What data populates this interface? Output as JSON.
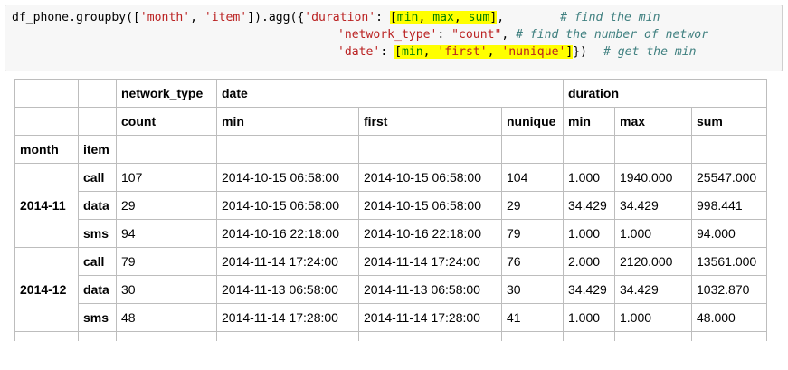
{
  "code": {
    "line1": {
      "prefix": "df_phone.groupby([",
      "s_month": "'month'",
      "comma1": ", ",
      "s_item": "'item'",
      "mid": "]).agg({",
      "s_duration": "'duration'",
      "colon1": ": ",
      "hl": {
        "open": "[",
        "min": "min",
        "c1": ", ",
        "max": "max",
        "c2": ", ",
        "sum": "sum",
        "close": "]"
      },
      "tail": ",",
      "comment": "# find the min"
    },
    "line2": {
      "s_network_type": "'network_type'",
      "colon": ": ",
      "s_count": "\"count\"",
      "tail": ", ",
      "comment": "# find the number of networ"
    },
    "line3": {
      "s_date": "'date'",
      "colon": ": ",
      "hl": {
        "open": "[",
        "min": "min",
        "c1": ", ",
        "s_first": "'first'",
        "c2": ", ",
        "s_nunique": "'nunique'",
        "close": "]"
      },
      "tail": "})",
      "comment": "# get the min"
    }
  },
  "table": {
    "header_row1": [
      "",
      "",
      "network_type",
      "date",
      "duration"
    ],
    "header_row2": [
      "",
      "",
      "count",
      "min",
      "first",
      "nunique",
      "min",
      "max",
      "sum"
    ],
    "index_names": [
      "month",
      "item"
    ],
    "groups": [
      {
        "month": "2014-11",
        "rows": [
          {
            "item": "call",
            "count": "107",
            "date_min": "2014-10-15 06:58:00",
            "date_first": "2014-10-15 06:58:00",
            "nunique": "104",
            "dur_min": "1.000",
            "dur_max": "1940.000",
            "dur_sum": "25547.000"
          },
          {
            "item": "data",
            "count": "29",
            "date_min": "2014-10-15 06:58:00",
            "date_first": "2014-10-15 06:58:00",
            "nunique": "29",
            "dur_min": "34.429",
            "dur_max": "34.429",
            "dur_sum": "998.441"
          },
          {
            "item": "sms",
            "count": "94",
            "date_min": "2014-10-16 22:18:00",
            "date_first": "2014-10-16 22:18:00",
            "nunique": "79",
            "dur_min": "1.000",
            "dur_max": "1.000",
            "dur_sum": "94.000"
          }
        ]
      },
      {
        "month": "2014-12",
        "rows": [
          {
            "item": "call",
            "count": "79",
            "date_min": "2014-11-14 17:24:00",
            "date_first": "2014-11-14 17:24:00",
            "nunique": "76",
            "dur_min": "2.000",
            "dur_max": "2120.000",
            "dur_sum": "13561.000"
          },
          {
            "item": "data",
            "count": "30",
            "date_min": "2014-11-13 06:58:00",
            "date_first": "2014-11-13 06:58:00",
            "nunique": "30",
            "dur_min": "34.429",
            "dur_max": "34.429",
            "dur_sum": "1032.870"
          },
          {
            "item": "sms",
            "count": "48",
            "date_min": "2014-11-14 17:28:00",
            "date_first": "2014-11-14 17:28:00",
            "nunique": "41",
            "dur_min": "1.000",
            "dur_max": "1.000",
            "dur_sum": "48.000"
          }
        ]
      }
    ]
  },
  "colors": {
    "highlight": "#ffff00",
    "string": "#ba2121",
    "builtin": "#008000",
    "comment": "#408080",
    "cell_bg": "#f7f7f7"
  }
}
